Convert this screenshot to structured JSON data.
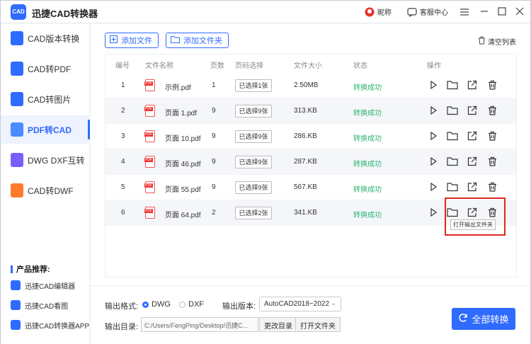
{
  "app": {
    "title": "迅捷CAD转换器",
    "logo_text": "CAD"
  },
  "titlebar": {
    "nickname": "昵称",
    "service": "客服中心"
  },
  "sidebar": {
    "items": [
      {
        "label": "CAD版本转换",
        "color": "#2f6bff"
      },
      {
        "label": "CAD转PDF",
        "color": "#2f6bff"
      },
      {
        "label": "CAD转图片",
        "color": "#2f6bff"
      },
      {
        "label": "PDF转CAD",
        "color": "#2f6bff",
        "active": true
      },
      {
        "label": "DWG DXF互转",
        "color": "#7b5cff"
      },
      {
        "label": "CAD转DWF",
        "color": "#ff7a2f"
      }
    ],
    "promo_title": "产品推荐:",
    "promo_items": [
      "迅捷CAD编辑器",
      "迅捷CAD看图",
      "迅捷CAD转换器APP"
    ]
  },
  "toolbar": {
    "add_file": "添加文件",
    "add_folder": "添加文件夹",
    "clear_list": "清空列表"
  },
  "table": {
    "headers": [
      "编号",
      "文件名称",
      "页数",
      "页码选择",
      "文件大小",
      "状态",
      "操作"
    ],
    "rows": [
      {
        "no": "1",
        "name": "示例.pdf",
        "pages": "1",
        "select": "已选择1张",
        "size": "2.50MB",
        "status": "转换成功"
      },
      {
        "no": "2",
        "name": "页面 1.pdf",
        "pages": "9",
        "select": "已选择9张",
        "size": "313.KB",
        "status": "转换成功"
      },
      {
        "no": "3",
        "name": "页面 10.pdf",
        "pages": "9",
        "select": "已选择9张",
        "size": "286.KB",
        "status": "转换成功"
      },
      {
        "no": "4",
        "name": "页面 46.pdf",
        "pages": "9",
        "select": "已选择9张",
        "size": "287.KB",
        "status": "转换成功"
      },
      {
        "no": "5",
        "name": "页面 55.pdf",
        "pages": "9",
        "select": "已选择9张",
        "size": "567.KB",
        "status": "转换成功"
      },
      {
        "no": "6",
        "name": "页面 64.pdf",
        "pages": "2",
        "select": "已选择2张",
        "size": "341.KB",
        "status": "转换成功"
      }
    ]
  },
  "tooltip": "打开输出文件夹",
  "output": {
    "format_label": "输出格式:",
    "format_dwg": "DWG",
    "format_dxf": "DXF",
    "version_label": "输出版本:",
    "version_value": "AutoCAD2018~2022",
    "dir_label": "输出目录:",
    "dir_value": "C:/Users/FengPing/Desktop/迅捷C...",
    "change_dir": "更改目录",
    "open_folder": "打开文件夹",
    "convert_all": "全部转换"
  },
  "colors": {
    "accent": "#2f6bff",
    "success": "#2cb56f",
    "highlight": "#e0281e"
  }
}
